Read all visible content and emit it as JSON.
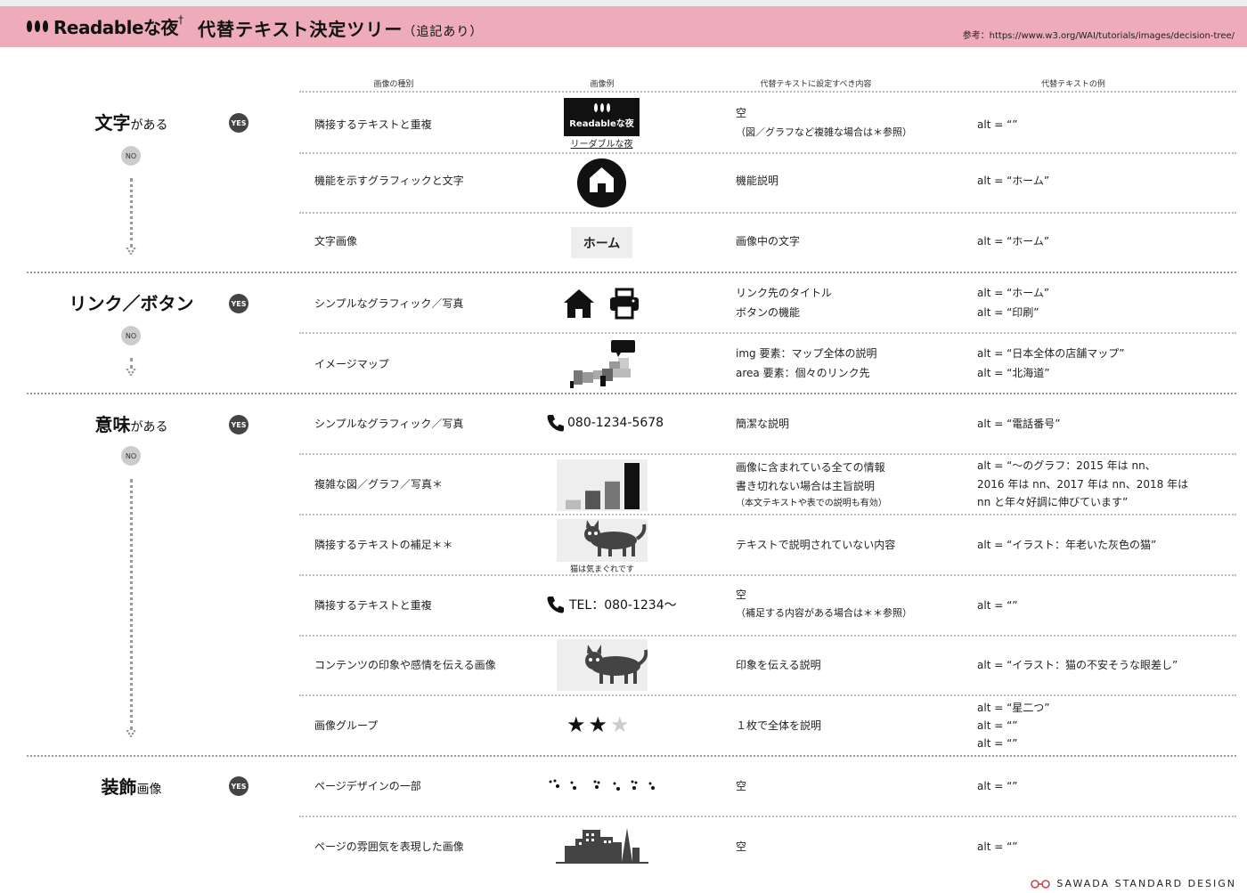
{
  "header": {
    "logo_text": "Readableな夜",
    "logo_mark": "†",
    "title": "代替テキスト決定ツリー",
    "title_note": "（追記あり）",
    "reference": "参考：https://www.w3.org/WAI/tutorials/images/decision-tree/"
  },
  "columns": {
    "type": "画像の種別",
    "example": "画像例",
    "content": "代替テキストに設定すべき内容",
    "alt_example": "代替テキストの例"
  },
  "badges": {
    "yes": "YES",
    "no": "NO"
  },
  "categories": [
    {
      "main": "文字",
      "suffix": "がある"
    },
    {
      "main": "リンク／ボタン",
      "suffix": ""
    },
    {
      "main": "意味",
      "suffix": "がある"
    },
    {
      "main": "装飾",
      "suffix": "画像"
    }
  ],
  "rows": [
    {
      "type": "隣接するテキストと重複",
      "content1": "空",
      "content2": "（図／グラフなど複雑な場合は＊参照）",
      "alt": [
        "alt = “”"
      ]
    },
    {
      "type": "機能を示すグラフィックと文字",
      "content1": "機能説明",
      "content2": "",
      "alt": [
        "alt = “ホーム”"
      ]
    },
    {
      "type": "文字画像",
      "content1": "画像中の文字",
      "content2": "",
      "alt": [
        "alt = “ホーム”"
      ]
    },
    {
      "type": "シンプルなグラフィック／写真",
      "content1": "リンク先のタイトル",
      "content2": "ボタンの機能",
      "alt": [
        "alt = “ホーム”",
        "alt = “印刷”"
      ]
    },
    {
      "type": "イメージマップ",
      "content1": "img 要素：マップ全体の説明",
      "content2": "area 要素：個々のリンク先",
      "alt": [
        "alt = “日本全体の店舗マップ”",
        "alt = “北海道”"
      ]
    },
    {
      "type": "シンプルなグラフィック／写真",
      "content1": "簡潔な説明",
      "content2": "",
      "alt": [
        "alt = “電話番号”"
      ]
    },
    {
      "type": "複雑な図／グラフ／写真＊",
      "content1": "画像に含まれている全ての情報",
      "content2": "書き切れない場合は主旨説明",
      "content3": "（本文テキストや表での説明も有効）",
      "alt": [
        "alt = “〜のグラフ：2015 年は nn、",
        "2016 年は nn、2017 年は nn、2018 年は",
        "nn と年々好調に伸びています”"
      ]
    },
    {
      "type": "隣接するテキストの補足＊＊",
      "content1": "テキストで説明されていない内容",
      "content2": "",
      "alt": [
        "alt = “イラスト：年老いた灰色の猫”"
      ]
    },
    {
      "type": "隣接するテキストと重複",
      "content1": "空",
      "content2": "（補足する内容がある場合は＊＊参照）",
      "alt": [
        "alt = “”"
      ]
    },
    {
      "type": "コンテンツの印象や感情を伝える画像",
      "content1": "印象を伝える説明",
      "content2": "",
      "alt": [
        "alt = “イラスト：猫の不安そうな眼差し”"
      ]
    },
    {
      "type": "画像グループ",
      "content1": "１枚で全体を説明",
      "content2": "",
      "alt": [
        "alt = “星二つ”",
        "alt = “”",
        "alt = “”"
      ]
    },
    {
      "type": "ページデザインの一部",
      "content1": "空",
      "content2": "",
      "alt": [
        "alt = “”"
      ]
    },
    {
      "type": "ページの雰囲気を表現した画像",
      "content1": "空",
      "content2": "",
      "alt": [
        "alt = “”"
      ]
    }
  ],
  "examples": {
    "logo_caption": "リーダブルな夜",
    "logo_text": "Readableな夜",
    "home_label": "ホーム",
    "home_text_button": "ホーム",
    "phone": "080-1234-5678",
    "tel": "TEL：080-1234〜",
    "cat_caption": "猫は気まぐれです",
    "chart_values": [
      1,
      2,
      3,
      5
    ]
  },
  "footer": {
    "credit": "SAWADA STANDARD DESIGN"
  }
}
